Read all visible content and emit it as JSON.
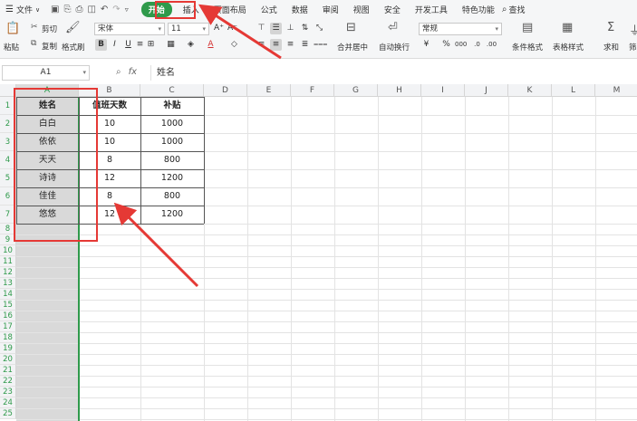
{
  "menubar": {
    "file_label": "文件",
    "tabs": [
      "开始",
      "插入",
      "页面布局",
      "公式",
      "数据",
      "审阅",
      "视图",
      "安全",
      "开发工具",
      "特色功能"
    ],
    "active_tab": "开始",
    "find_label": "查找"
  },
  "ribbon": {
    "paste": "粘贴",
    "cut": "剪切",
    "copy": "复制",
    "format_painter": "格式刷",
    "font_name": "宋体",
    "font_size": "11",
    "merge_center": "合并居中",
    "wrap_text": "自动换行",
    "number_format": "常规",
    "conditional_format": "条件格式",
    "table_style": "表格样式",
    "sum": "求和",
    "filter": "筛"
  },
  "formula_bar": {
    "name_box": "A1",
    "fx_label": "fx",
    "content": "姓名"
  },
  "sheet": {
    "columns": [
      "A",
      "B",
      "C",
      "D",
      "E",
      "F",
      "G",
      "H",
      "I",
      "J",
      "K",
      "L",
      "M"
    ],
    "rows": [
      "1",
      "2",
      "3",
      "4",
      "5",
      "6",
      "7",
      "8",
      "9",
      "10",
      "11",
      "12",
      "13",
      "14",
      "15",
      "16",
      "17",
      "18",
      "19",
      "20",
      "21",
      "22",
      "23",
      "24",
      "25"
    ],
    "table": {
      "headers": [
        "姓名",
        "值班天数",
        "补贴"
      ],
      "data": [
        [
          "白白",
          "10",
          "1000"
        ],
        [
          "依依",
          "10",
          "1000"
        ],
        [
          "天天",
          "8",
          "800"
        ],
        [
          "诗诗",
          "12",
          "1200"
        ],
        [
          "佳佳",
          "8",
          "800"
        ],
        [
          "悠悠",
          "12",
          "1200"
        ]
      ]
    }
  },
  "colors": {
    "accent": "#2f9a4b",
    "annotation": "#e53935",
    "selected_column": "#d9d9d9"
  }
}
